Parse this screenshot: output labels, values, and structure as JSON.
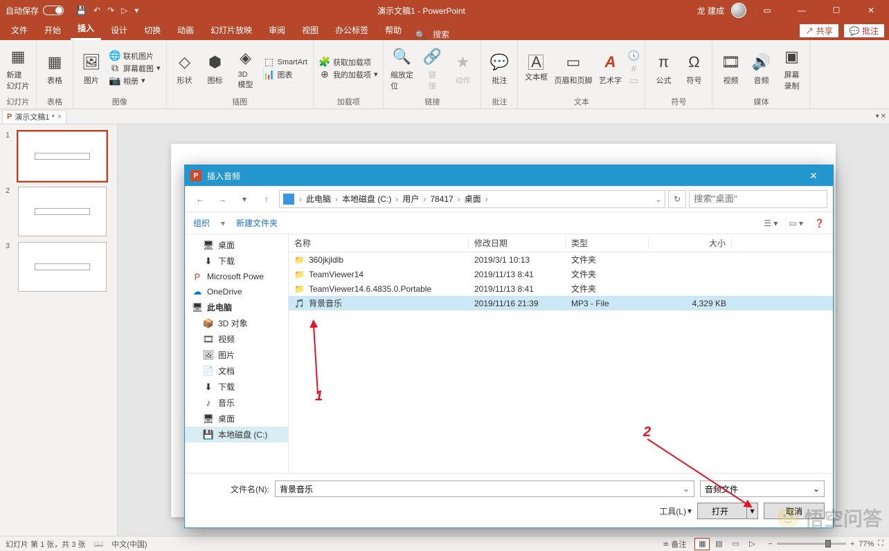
{
  "titlebar": {
    "autosave": "自动保存",
    "title": "演示文稿1 - PowerPoint",
    "username": "龙 建成"
  },
  "menubar": {
    "tabs": [
      "文件",
      "开始",
      "插入",
      "设计",
      "切换",
      "动画",
      "幻灯片放映",
      "审阅",
      "视图",
      "办公标签",
      "帮助"
    ],
    "search_hint": "搜索",
    "share": "共享",
    "comments": "批注"
  },
  "ribbon": {
    "groups": {
      "slides": {
        "label": "幻灯片",
        "new_slide": "新建\n幻灯片"
      },
      "tables": {
        "label": "表格",
        "table": "表格"
      },
      "images": {
        "label": "图像",
        "picture": "图片",
        "online": "联机图片",
        "screenshot": "屏幕截图",
        "album": "相册"
      },
      "illustrations": {
        "label": "插图",
        "shapes": "形状",
        "icons": "图标",
        "3d": "3D\n模型",
        "smartart": "SmartArt",
        "chart": "图表"
      },
      "addins": {
        "label": "加载项",
        "get": "获取加载项",
        "my": "我的加载项"
      },
      "links": {
        "label": "链接",
        "zoom": "缩放定\n位",
        "link": "链\n接",
        "action": "动作"
      },
      "comments": {
        "label": "批注",
        "comment": "批注"
      },
      "text": {
        "label": "文本",
        "textbox": "文本框",
        "headerfooter": "页眉和页脚",
        "wordart": "艺术字"
      },
      "symbols": {
        "label": "符号",
        "equation": "公式",
        "symbol": "符号"
      },
      "media": {
        "label": "媒体",
        "video": "视频",
        "audio": "音频",
        "screenrec": "屏幕\n录制"
      }
    }
  },
  "doctab": "演示文稿1 *",
  "thumbs": {
    "items": [
      {
        "num": "1"
      },
      {
        "num": "2"
      },
      {
        "num": "3"
      }
    ]
  },
  "dialog": {
    "title": "插入音频",
    "crumbs": [
      "此电脑",
      "本地磁盘 (C:)",
      "用户",
      "78417",
      "桌面"
    ],
    "search_placeholder": "搜索\"桌面\"",
    "organize": "组织",
    "newfolder": "新建文件夹",
    "columns": {
      "name": "名称",
      "date": "修改日期",
      "type": "类型",
      "size": "大小"
    },
    "tree": [
      {
        "label": "桌面",
        "icon": "🖥",
        "indent": true
      },
      {
        "label": "下载",
        "icon": "⬇",
        "indent": true
      },
      {
        "label": "Microsoft Powe",
        "icon": "P",
        "indent": false,
        "color": "#d24726"
      },
      {
        "label": "OneDrive",
        "icon": "☁",
        "indent": false,
        "color": "#0078d4"
      },
      {
        "label": "此电脑",
        "icon": "🖥",
        "indent": false,
        "bold": true
      },
      {
        "label": "3D 对象",
        "icon": "📦",
        "indent": true
      },
      {
        "label": "视频",
        "icon": "🎞",
        "indent": true
      },
      {
        "label": "图片",
        "icon": "🖼",
        "indent": true
      },
      {
        "label": "文档",
        "icon": "📄",
        "indent": true
      },
      {
        "label": "下载",
        "icon": "⬇",
        "indent": true
      },
      {
        "label": "音乐",
        "icon": "♪",
        "indent": true
      },
      {
        "label": "桌面",
        "icon": "🖥",
        "indent": true
      },
      {
        "label": "本地磁盘 (C:)",
        "icon": "💾",
        "indent": true,
        "selected": true
      }
    ],
    "rows": [
      {
        "name": "360jkjldlb",
        "date": "2019/3/1 10:13",
        "type": "文件夹",
        "size": "",
        "kind": "folder"
      },
      {
        "name": "TeamViewer14",
        "date": "2019/11/13 8:41",
        "type": "文件夹",
        "size": "",
        "kind": "folder"
      },
      {
        "name": "TeamViewer14.6.4835.0.Portable",
        "date": "2019/11/13 8:41",
        "type": "文件夹",
        "size": "",
        "kind": "folder"
      },
      {
        "name": "背景音乐",
        "date": "2019/11/16 21:39",
        "type": "MP3 - File",
        "size": "4,329 KB",
        "kind": "mp3",
        "selected": true
      }
    ],
    "filename_label": "文件名(N):",
    "filename_value": "背景音乐",
    "filter": "音频文件",
    "tools": "工具(L)",
    "open": "打开",
    "cancel": "取消"
  },
  "annotations": {
    "a1": "1",
    "a2": "2"
  },
  "statusbar": {
    "page": "幻灯片 第 1 张，共 3 张",
    "lang": "中文(中国)",
    "notes": "备注",
    "zoom": "77%"
  },
  "watermark": "悟空问答"
}
